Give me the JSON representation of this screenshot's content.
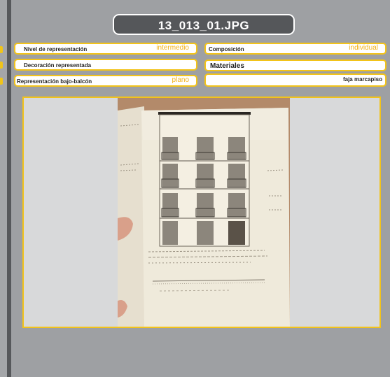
{
  "title": "13_013_01.JPG",
  "fields": {
    "nivel": {
      "label": "Nivel de representación",
      "value": "intermedio"
    },
    "composicion": {
      "label": "Composición",
      "value": "individual"
    },
    "decoracion": {
      "label": "Decoración representada",
      "value": ""
    },
    "materiales": {
      "label": "Materiales",
      "value": ""
    },
    "bajo_balcon": {
      "label": "Representación bajo-balcón",
      "value": "plano"
    },
    "faja": {
      "label": "faja marcapiso",
      "value": ""
    }
  },
  "colors": {
    "accent": "#f2c31a",
    "panel": "#9ea0a3",
    "title_bg": "#55575a"
  }
}
